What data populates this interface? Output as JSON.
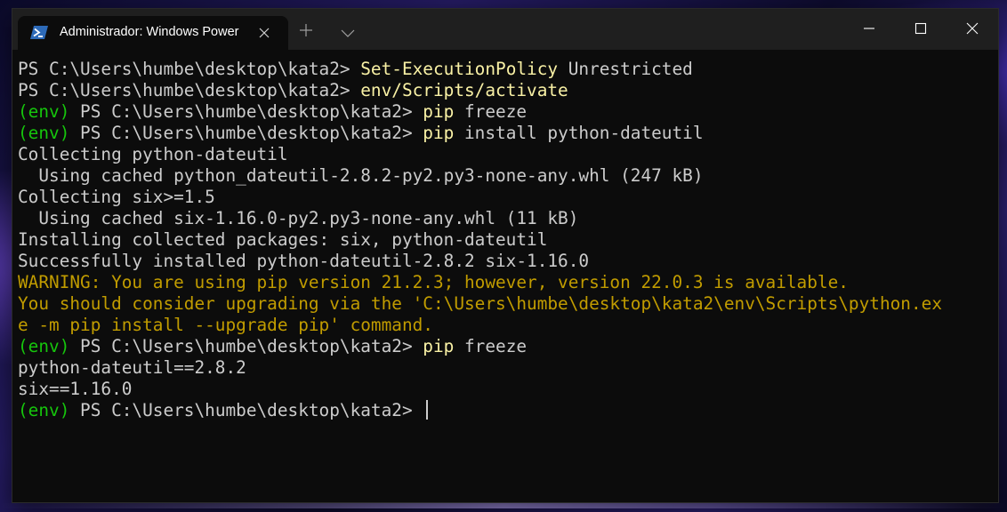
{
  "window": {
    "tab_title": "Administrador: Windows Power",
    "tab_icon": "powershell-icon",
    "accent": "#2d6ab8"
  },
  "colors": {
    "env_prompt": "#16c60c",
    "command": "#f9f1a5",
    "warning": "#c19c00",
    "text": "#cccccc",
    "background": "#0c0c0c"
  },
  "terminal": {
    "lines": [
      {
        "prompt": "PS C:\\Users\\humbe\\desktop\\kata2> ",
        "cmd": "Set-ExecutionPolicy",
        "args": " Unrestricted"
      },
      {
        "prompt": "PS C:\\Users\\humbe\\desktop\\kata2> ",
        "cmd": "env/Scripts/activate"
      },
      {
        "env": "(env)",
        "prompt": " PS C:\\Users\\humbe\\desktop\\kata2> ",
        "cmd": "pip",
        "args": " freeze"
      },
      {
        "env": "(env)",
        "prompt": " PS C:\\Users\\humbe\\desktop\\kata2> ",
        "cmd": "pip",
        "args": " install python-dateutil"
      },
      {
        "output": "Collecting python-dateutil"
      },
      {
        "output": "  Using cached python_dateutil-2.8.2-py2.py3-none-any.whl (247 kB)"
      },
      {
        "output": "Collecting six>=1.5"
      },
      {
        "output": "  Using cached six-1.16.0-py2.py3-none-any.whl (11 kB)"
      },
      {
        "output": "Installing collected packages: six, python-dateutil"
      },
      {
        "output": "Successfully installed python-dateutil-2.8.2 six-1.16.0"
      },
      {
        "warning": "WARNING: You are using pip version 21.2.3; however, version 22.0.3 is available."
      },
      {
        "warning": "You should consider upgrading via the 'C:\\Users\\humbe\\desktop\\kata2\\env\\Scripts\\python.ex"
      },
      {
        "warning": "e -m pip install --upgrade pip' command."
      },
      {
        "env": "(env)",
        "prompt": " PS C:\\Users\\humbe\\desktop\\kata2> ",
        "cmd": "pip",
        "args": " freeze"
      },
      {
        "output": "python-dateutil==2.8.2"
      },
      {
        "output": "six==1.16.0"
      },
      {
        "env": "(env)",
        "prompt": " PS C:\\Users\\humbe\\desktop\\kata2> ",
        "cursor": true
      }
    ]
  }
}
